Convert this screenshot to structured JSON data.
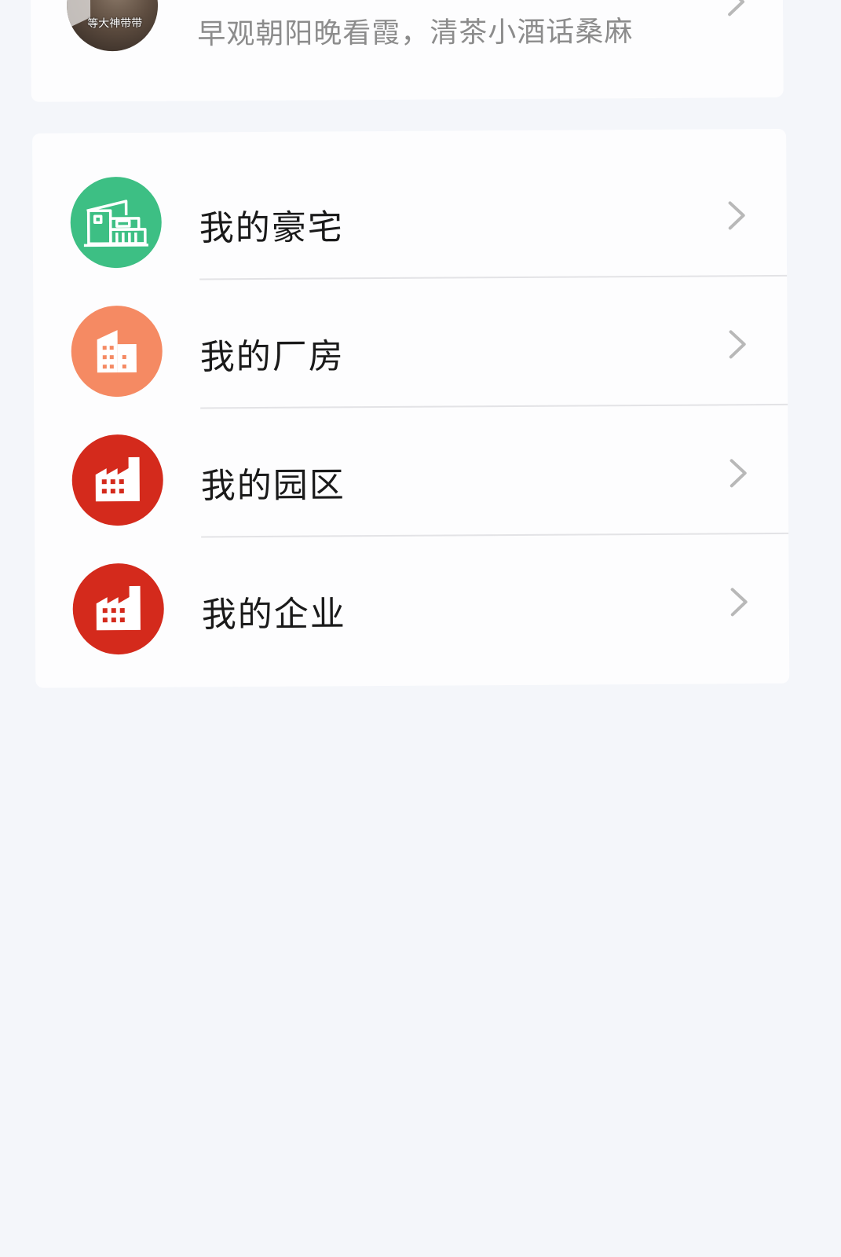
{
  "colors": {
    "page_background": "#f4f6fa",
    "card_background": "#fdfdfe",
    "house_icon_green": "#3dbf84",
    "plant_icon_orange": "#f58a63",
    "factory_icon_red": "#d42a1c",
    "chevron_gray": "#b8b8b8"
  },
  "profile": {
    "avatar_caption": "等大神带带",
    "name_partial": "",
    "bio": "早观朝阳晚看霞，清茶小酒话桑麻",
    "chevron_icon": "chevron-right-icon"
  },
  "menu": {
    "items": [
      {
        "label": "我的豪宅",
        "icon": "villa-icon",
        "color": "#3dbf84"
      },
      {
        "label": "我的厂房",
        "icon": "building-icon",
        "color": "#f58a63"
      },
      {
        "label": "我的园区",
        "icon": "factory-icon",
        "color": "#d42a1c"
      },
      {
        "label": "我的企业",
        "icon": "factory-icon",
        "color": "#d42a1c"
      }
    ]
  }
}
